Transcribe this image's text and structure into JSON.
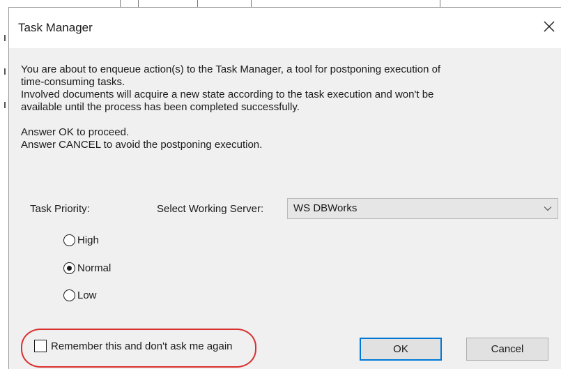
{
  "dialog": {
    "title": "Task Manager",
    "close_icon": "close-icon",
    "message_lines": [
      "You are about to enqueue action(s) to the Task Manager, a tool for postponing execution of",
      "time-consuming tasks.",
      "Involved documents will acquire a new state according to the task execution and won't be",
      "available until the process has been completed successfully.",
      "Answer OK to proceed.",
      "Answer CANCEL to avoid the postponing execution."
    ]
  },
  "priority": {
    "label": "Task Priority:",
    "options": [
      {
        "label": "High",
        "selected": false
      },
      {
        "label": "Normal",
        "selected": true
      },
      {
        "label": "Low",
        "selected": false
      }
    ]
  },
  "server": {
    "label": "Select Working Server:",
    "selected": "WS DBWorks",
    "chevron_icon": "chevron-down-icon"
  },
  "remember": {
    "label": "Remember this and don't ask me again",
    "checked": false,
    "highlight_color": "#d9302f"
  },
  "buttons": {
    "ok": "OK",
    "cancel": "Cancel"
  },
  "colors": {
    "dialog_background": "#f0f0f0",
    "default_button_border": "#0078d7"
  }
}
